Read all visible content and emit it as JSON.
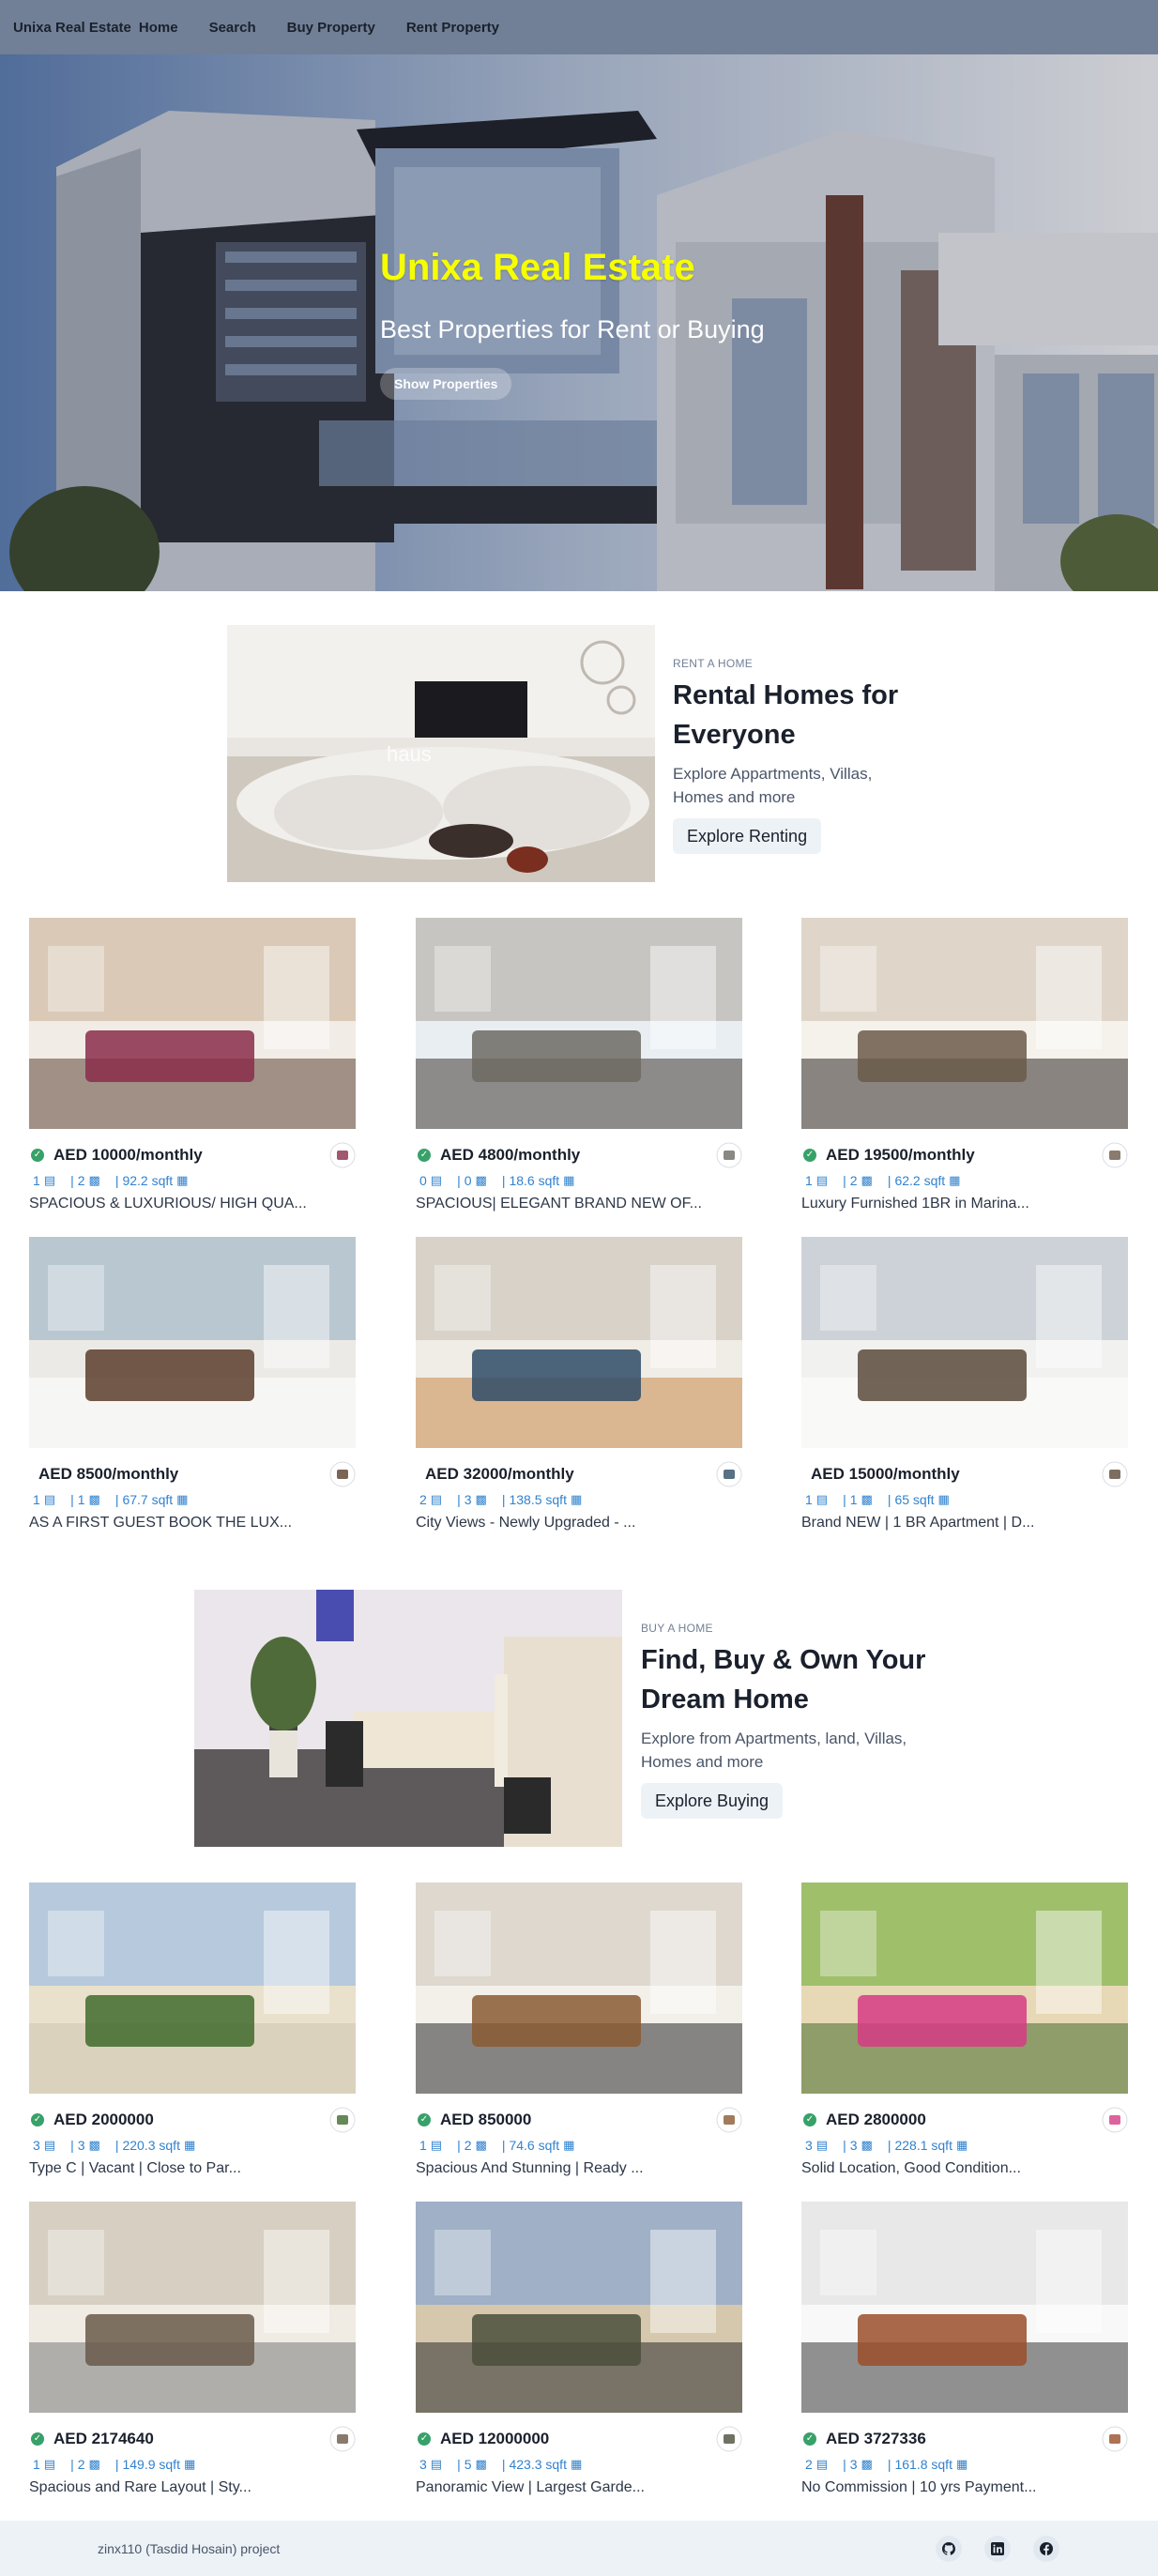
{
  "nav": {
    "brand": "Unixa Real Estate",
    "links": [
      "Home",
      "Search",
      "Buy Property",
      "Rent Property"
    ]
  },
  "hero": {
    "title": "Unixa Real Estate",
    "subtitle": "Best Properties for Rent or Buying",
    "button": "Show Properties"
  },
  "rent_banner": {
    "kicker": "RENT A HOME",
    "title": "Rental Homes for Everyone",
    "description": "Explore Appartments, Villas, Homes and more",
    "button": "Explore Renting"
  },
  "rent_listings": [
    {
      "price": "AED 10000/monthly",
      "verified": true,
      "rooms": "1",
      "baths": "2",
      "area": "92.2 sqft",
      "title": "SPACIOUS & LUXURIOUS/ HIGH QUA..."
    },
    {
      "price": "AED 4800/monthly",
      "verified": true,
      "rooms": "0",
      "baths": "0",
      "area": "18.6 sqft",
      "title": "SPACIOUS| ELEGANT BRAND NEW OF..."
    },
    {
      "price": "AED 19500/monthly",
      "verified": true,
      "rooms": "1",
      "baths": "2",
      "area": "62.2 sqft",
      "title": "Luxury Furnished 1BR in Marina..."
    },
    {
      "price": "AED 8500/monthly",
      "verified": false,
      "rooms": "1",
      "baths": "1",
      "area": "67.7 sqft",
      "title": "AS A FIRST GUEST BOOK THE LUX..."
    },
    {
      "price": "AED 32000/monthly",
      "verified": false,
      "rooms": "2",
      "baths": "3",
      "area": "138.5 sqft",
      "title": "City Views - Newly Upgraded - ..."
    },
    {
      "price": "AED 15000/monthly",
      "verified": false,
      "rooms": "1",
      "baths": "1",
      "area": "65 sqft",
      "title": "Brand NEW | 1 BR Apartment | D..."
    }
  ],
  "buy_banner": {
    "kicker": "BUY A HOME",
    "title": "Find, Buy & Own Your Dream Home",
    "description": "Explore from Apartments, land, Villas, Homes and more",
    "button": "Explore Buying"
  },
  "buy_listings": [
    {
      "price": "AED 2000000",
      "verified": true,
      "rooms": "3",
      "baths": "3",
      "area": "220.3 sqft",
      "title": "Type C | Vacant | Close to Par..."
    },
    {
      "price": "AED 850000",
      "verified": true,
      "rooms": "1",
      "baths": "2",
      "area": "74.6 sqft",
      "title": "Spacious And Stunning | Ready ..."
    },
    {
      "price": "AED 2800000",
      "verified": true,
      "rooms": "3",
      "baths": "3",
      "area": "228.1 sqft",
      "title": "Solid Location, Good Condition..."
    },
    {
      "price": "AED 2174640",
      "verified": true,
      "rooms": "1",
      "baths": "2",
      "area": "149.9 sqft",
      "title": "Spacious and Rare Layout | Sty..."
    },
    {
      "price": "AED 12000000",
      "verified": true,
      "rooms": "3",
      "baths": "5",
      "area": "423.3 sqft",
      "title": "Panoramic View | Largest Garde..."
    },
    {
      "price": "AED 3727336",
      "verified": true,
      "rooms": "2",
      "baths": "3",
      "area": "161.8 sqft",
      "title": "No Commission | 10 yrs Payment..."
    }
  ],
  "footer": {
    "text": "zinx110 (Tasdid Hosain) project",
    "icons": [
      "github-icon",
      "linkedin-icon",
      "facebook-icon"
    ]
  },
  "colors": {
    "navbar": "#718096",
    "hero_title": "#f6ff00",
    "accent_blue": "#3182ce",
    "verified_green": "#38a169"
  }
}
